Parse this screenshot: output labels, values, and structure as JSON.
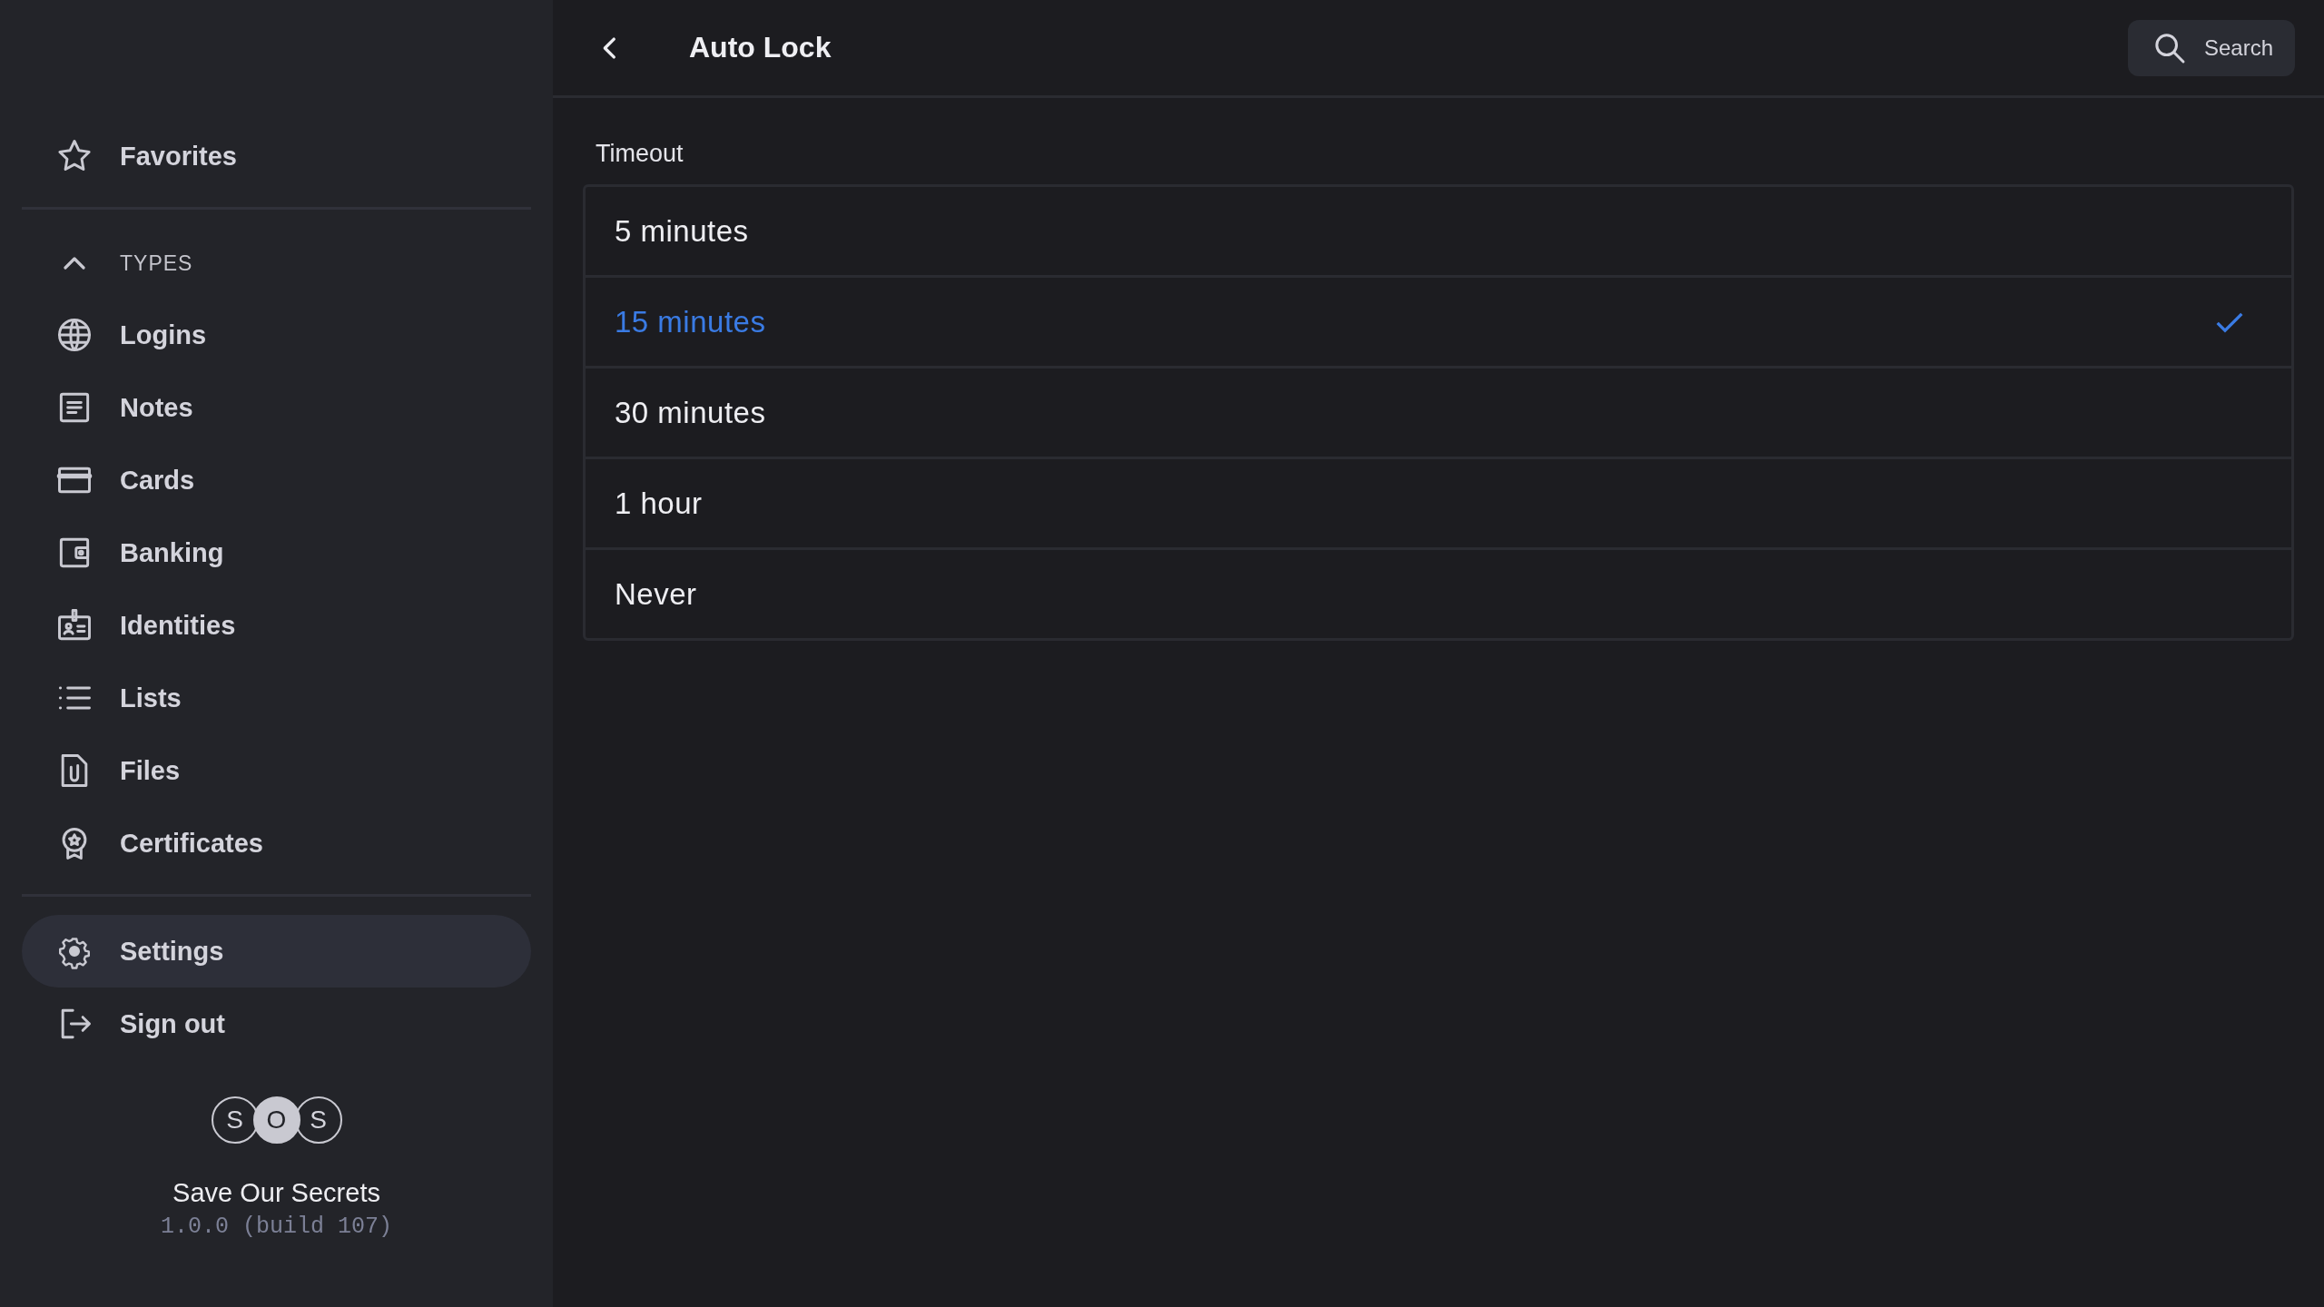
{
  "sidebar": {
    "top": [
      {
        "label": "Favorites",
        "selected": false
      }
    ],
    "types": {
      "label": "TYPES",
      "expanded": true,
      "items": [
        {
          "label": "Logins",
          "selected": false
        },
        {
          "label": "Notes",
          "selected": false
        },
        {
          "label": "Cards",
          "selected": false
        },
        {
          "label": "Banking",
          "selected": false
        },
        {
          "label": "Identities",
          "selected": false
        },
        {
          "label": "Lists",
          "selected": false
        },
        {
          "label": "Files",
          "selected": false
        },
        {
          "label": "Certificates",
          "selected": false
        }
      ]
    },
    "bottom": [
      {
        "label": "Settings",
        "selected": true
      },
      {
        "label": "Sign out",
        "selected": false
      }
    ],
    "logo": [
      "S",
      "O",
      "S"
    ],
    "app_name": "Save Our Secrets",
    "version": "1.0.0 (build 107)"
  },
  "header": {
    "title": "Auto Lock",
    "search": {
      "label": "Search"
    }
  },
  "timeout": {
    "label": "Timeout",
    "options": [
      {
        "label": "5 minutes",
        "selected": false
      },
      {
        "label": "15 minutes",
        "selected": true
      },
      {
        "label": "30 minutes",
        "selected": false
      },
      {
        "label": "1 hour",
        "selected": false
      },
      {
        "label": "Never",
        "selected": false
      }
    ]
  }
}
